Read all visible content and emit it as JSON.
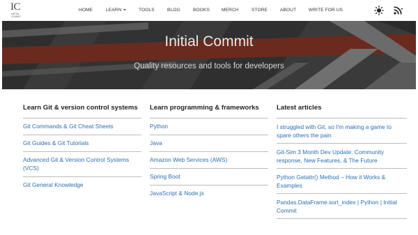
{
  "logo": {
    "mark": "IC",
    "tagline": "INITIAL COMMIT"
  },
  "nav": {
    "items": [
      {
        "label": "HOME"
      },
      {
        "label": "LEARN"
      },
      {
        "label": "TOOLS"
      },
      {
        "label": "BLOG"
      },
      {
        "label": "BOOKS"
      },
      {
        "label": "MERCH"
      },
      {
        "label": "STORE"
      },
      {
        "label": "ABOUT"
      },
      {
        "label": "WRITE FOR US"
      }
    ],
    "icons": {
      "theme": "sun-icon",
      "feed": "rss-icon"
    }
  },
  "hero": {
    "title": "Initial Commit",
    "subtitle": "Quality resources and tools for developers",
    "colors": {
      "background": "#3a3a3a",
      "band": "#6b2a1e",
      "stripe": "#7a7a7a"
    }
  },
  "columns": [
    {
      "heading": "Learn Git & version control systems",
      "items": [
        "Git Commands & Git Cheat Sheets",
        "Git Guides & Git Tutorials",
        "Advanced Git & Version Control Systems (VCS)",
        "Git General Knowledge"
      ]
    },
    {
      "heading": "Learn programming & frameworks",
      "items": [
        "Python",
        "Java",
        "Amazon Web Services (AWS)",
        "Spring Boot",
        "JavaScript & Node.js"
      ]
    },
    {
      "heading": "Latest articles",
      "items": [
        "I struggled with Git, so I'm making a game to spare others the pain",
        "Git-Sim 3 Month Dev Update: Community response, New Features, & The Future",
        "Python Getattr() Method – How it Works & Examples",
        "Pandas.DataFrame.sort_index | Python | Initial Commit"
      ]
    }
  ],
  "colors": {
    "link": "#2a6fb3",
    "divider": "#bbbbbb",
    "heading": "#222222"
  }
}
